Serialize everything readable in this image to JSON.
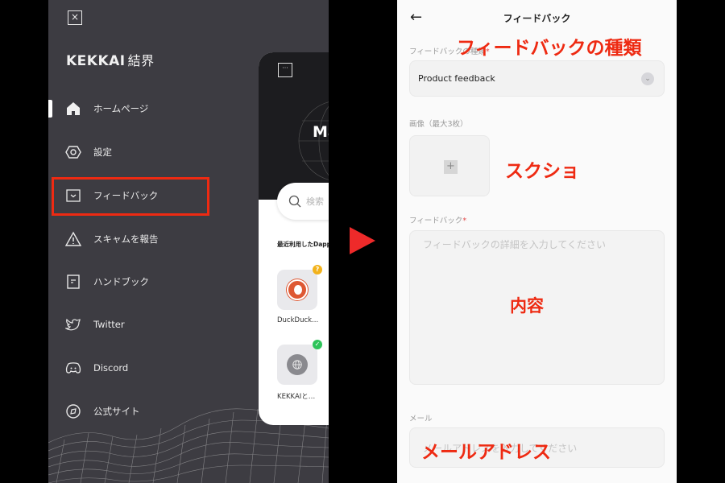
{
  "left_screen": {
    "close_icon": "×",
    "logo": {
      "brand": "KEKKAI",
      "kanji": "結界"
    },
    "menu": [
      {
        "label": "ホームページ",
        "icon": "home-icon",
        "active": true
      },
      {
        "label": "設定",
        "icon": "settings-hexagon-icon",
        "active": false
      },
      {
        "label": "フィードバック",
        "icon": "feedback-chevron-icon",
        "active": false,
        "highlighted": true
      },
      {
        "label": "スキャムを報告",
        "icon": "warning-triangle-icon",
        "active": false
      },
      {
        "label": "ハンドブック",
        "icon": "handbook-icon",
        "active": false
      },
      {
        "label": "Twitter",
        "icon": "twitter-icon",
        "active": false
      },
      {
        "label": "Discord",
        "icon": "discord-icon",
        "active": false
      },
      {
        "label": "公式サイト",
        "icon": "compass-icon",
        "active": false
      }
    ],
    "card": {
      "menu_icon": "···",
      "heading_partial": "Ma",
      "search_placeholder": "検索",
      "recent_title": "最近利用したDapp",
      "dapps": [
        {
          "name": "DuckDuck...",
          "badge": "?",
          "badge_color": "#f2b21b"
        },
        {
          "name": "KEKKAIと…",
          "badge": "✓",
          "badge_color": "#2ec45a"
        }
      ]
    }
  },
  "arrow": {
    "color": "#ee2a2a"
  },
  "right_screen": {
    "back_icon": "←",
    "title": "フィードバック",
    "type_field": {
      "label": "フィードバックの種類",
      "required": "*",
      "value": "Product feedback"
    },
    "image_field": {
      "label": "画像（最大3枚）",
      "add_icon": "+"
    },
    "feedback_field": {
      "label": "フィードバック",
      "required": "*",
      "placeholder": "フィードバックの詳細を入力してください"
    },
    "email_field": {
      "label": "メール",
      "placeholder": "メールアドレスを入力してください"
    }
  },
  "annotations": {
    "color": "#ee2a12",
    "type": "フィードバックの種類",
    "screenshot": "スクショ",
    "content": "内容",
    "email": "メールアドレス"
  }
}
